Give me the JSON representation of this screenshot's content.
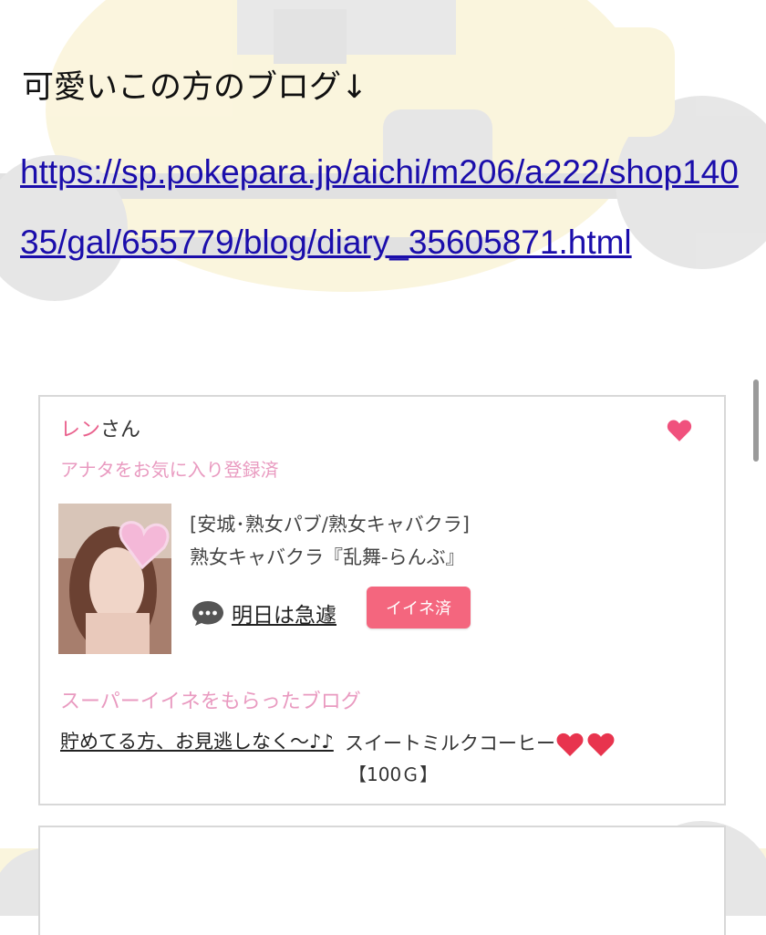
{
  "post": {
    "heading": "可愛いこの方のブログ↓",
    "url": "https://sp.pokepara.jp/aichi/m206/a222/shop14035/gal/655779/blog/diary_35605871.html"
  },
  "card": {
    "cast_name": "レン",
    "name_suffix": "さん",
    "favorite_status": "アナタをお気に入り登録済",
    "shop_category": "[安城･熟女パブ/熟女キャバクラ]",
    "shop_name": "熟女キャバクラ『乱舞-らんぶ』",
    "latest_post_title": "明日は急遽",
    "iine_button_label": "イイネ済",
    "super_iine_label": "スーパーイイネをもらったブログ",
    "super_blog_title": "貯めてる方、お見逃しなく〜♪♪",
    "gift_name": "スイートミルクコーヒー",
    "gift_price": "【100Ｇ】"
  },
  "colors": {
    "link": "#1a0dab",
    "accent_pink": "#e9608c",
    "button_pink": "#f4667e",
    "heart_red": "#e8344e"
  },
  "icons": [
    "heart-icon",
    "comment-icon",
    "red-heart-emoji"
  ]
}
